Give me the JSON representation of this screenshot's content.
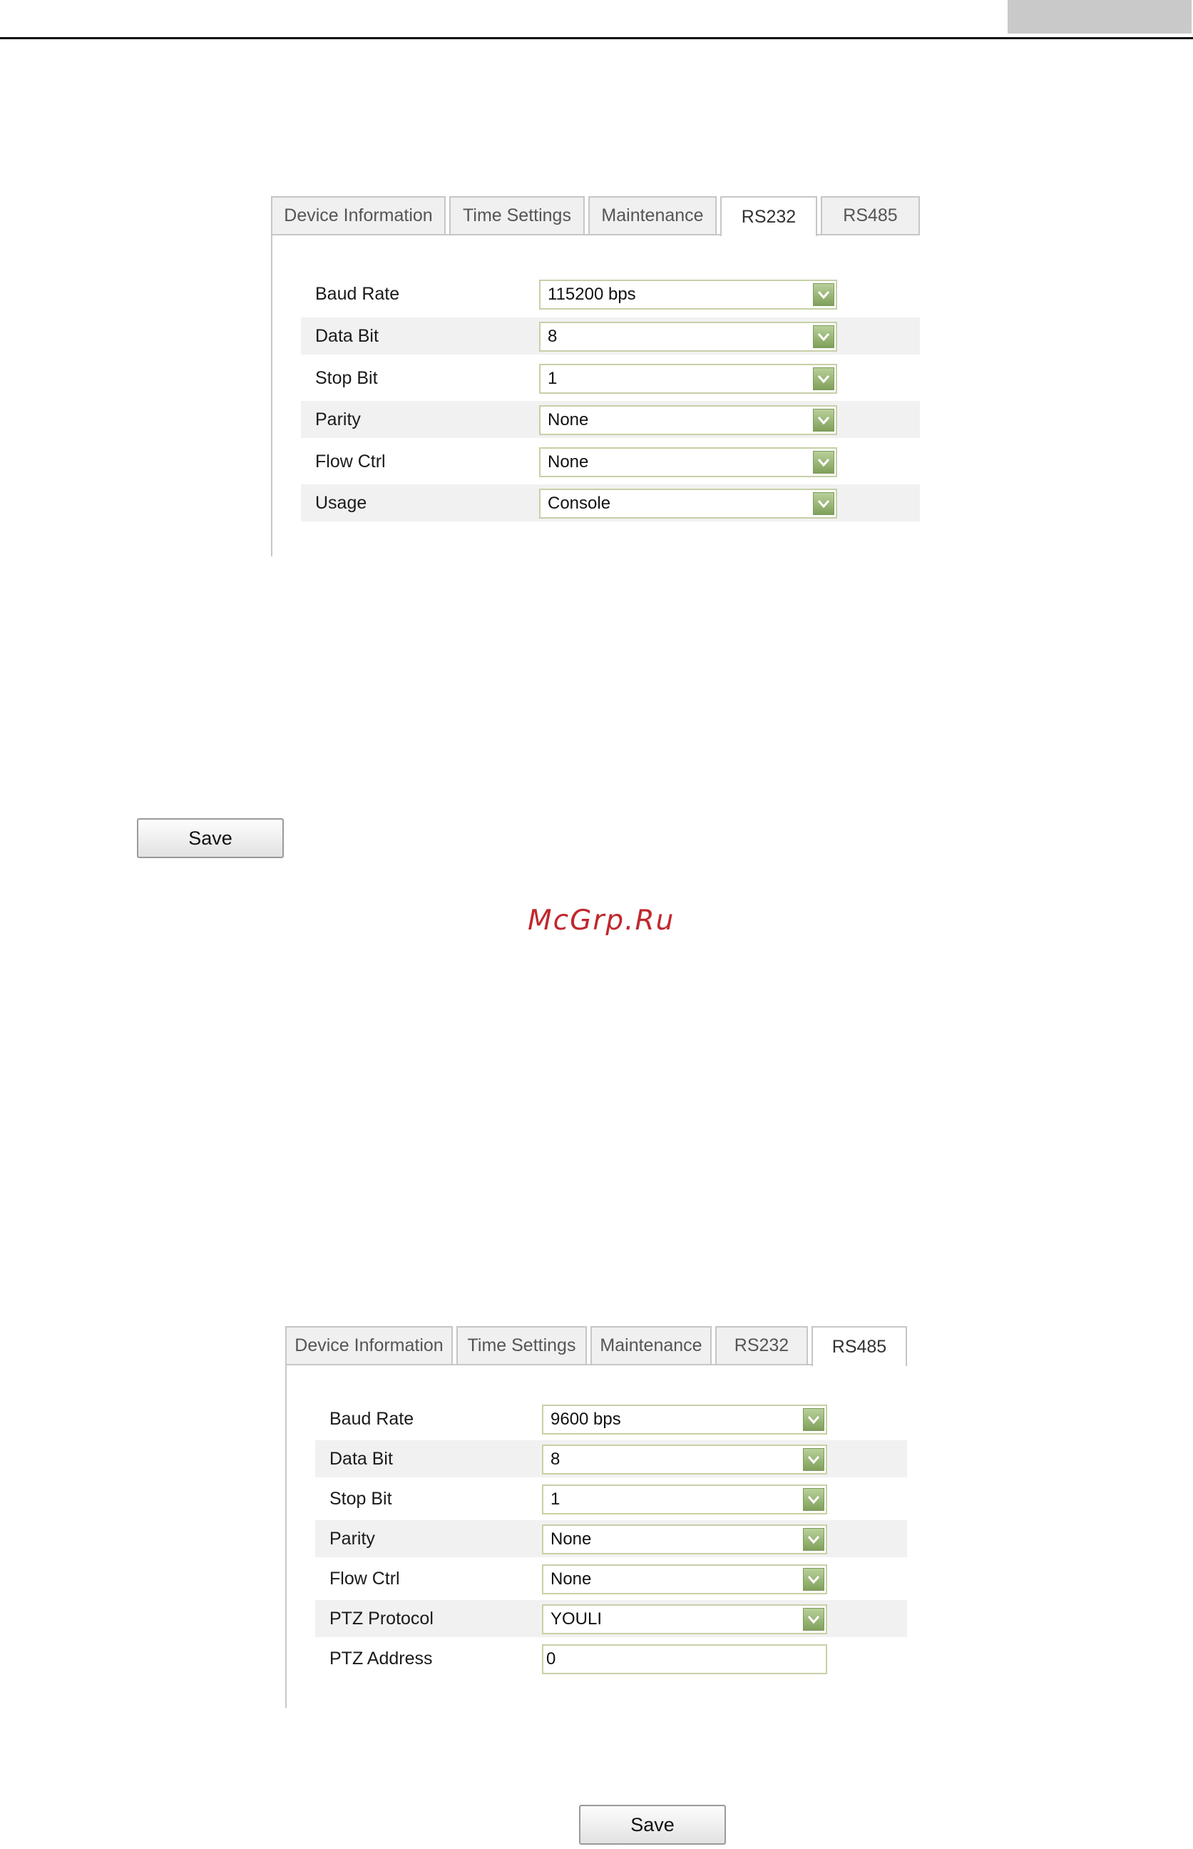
{
  "watermark": "McGrp.Ru",
  "rs232_panel": {
    "tabs": [
      "Device Information",
      "Time Settings",
      "Maintenance",
      "RS232",
      "RS485"
    ],
    "active_tab": "RS232",
    "fields": [
      {
        "label": "Baud Rate",
        "value": "115200 bps"
      },
      {
        "label": "Data Bit",
        "value": "8"
      },
      {
        "label": "Stop Bit",
        "value": "1"
      },
      {
        "label": "Parity",
        "value": "None"
      },
      {
        "label": "Flow Ctrl",
        "value": "None"
      },
      {
        "label": "Usage",
        "value": "Console"
      }
    ],
    "save_label": "Save"
  },
  "rs485_panel": {
    "tabs": [
      "Device Information",
      "Time Settings",
      "Maintenance",
      "RS232",
      "RS485"
    ],
    "active_tab": "RS485",
    "fields": [
      {
        "label": "Baud Rate",
        "value": "9600 bps"
      },
      {
        "label": "Data Bit",
        "value": "8"
      },
      {
        "label": "Stop Bit",
        "value": "1"
      },
      {
        "label": "Parity",
        "value": "None"
      },
      {
        "label": "Flow Ctrl",
        "value": "None"
      },
      {
        "label": "PTZ Protocol",
        "value": "YOULI"
      },
      {
        "label": "PTZ Address",
        "value": "0"
      }
    ],
    "save_label": "Save"
  }
}
